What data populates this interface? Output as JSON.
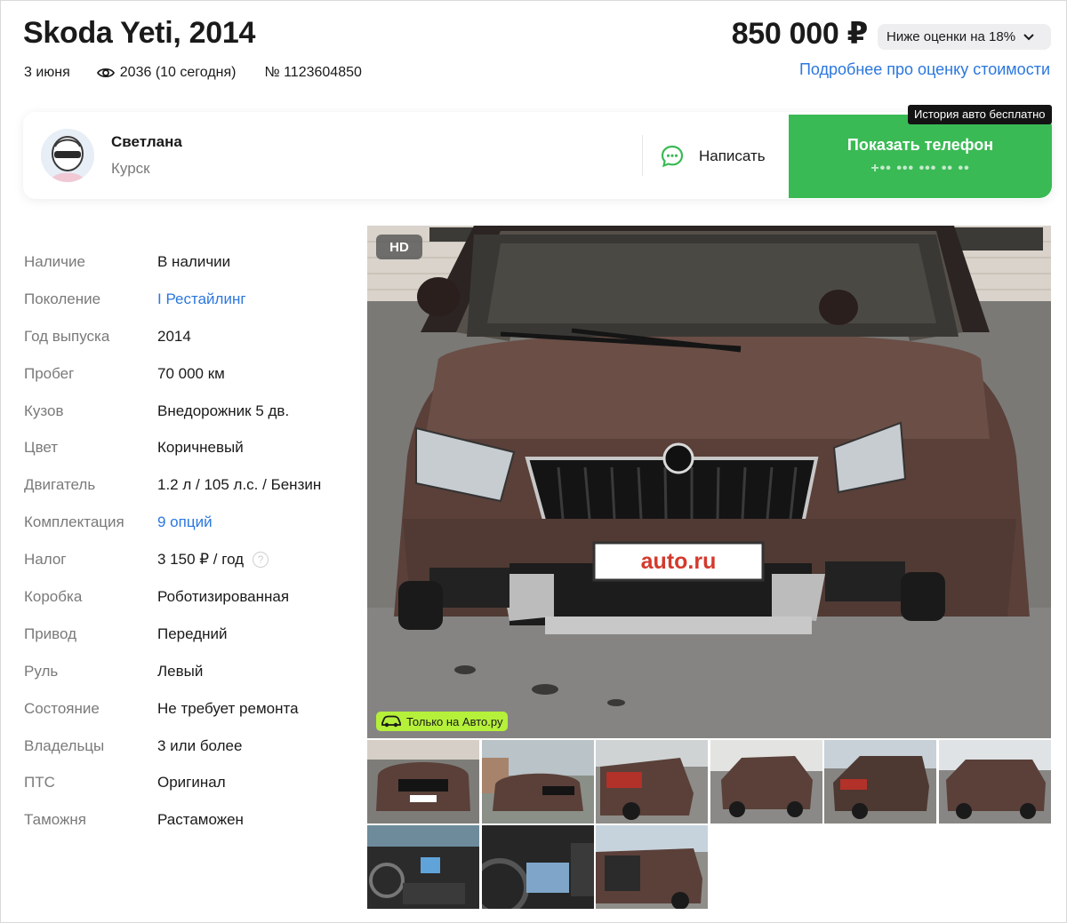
{
  "header": {
    "title": "Skoda Yeti, 2014",
    "date": "3 июня",
    "views": "2036 (10 сегодня)",
    "listing_number": "№ 1123604850",
    "price": "850 000 ₽",
    "rating_badge": "Ниже оценки на 18%",
    "rating_link": "Подробнее про оценку стоимости"
  },
  "seller": {
    "name": "Светлана",
    "city": "Курск",
    "write_label": "Написать",
    "phone_label": "Показать телефон",
    "phone_mask": "+•• ••• ••• •• ••",
    "history_tooltip": "История авто бесплатно"
  },
  "specs": [
    {
      "key": "Наличие",
      "value": "В наличии"
    },
    {
      "key": "Поколение",
      "value": "I Рестайлинг"
    },
    {
      "key": "Год выпуска",
      "value": "2014"
    },
    {
      "key": "Пробег",
      "value": "70 000 км"
    },
    {
      "key": "Кузов",
      "value": "Внедорожник 5 дв."
    },
    {
      "key": "Цвет",
      "value": "Коричневый"
    },
    {
      "key": "Двигатель",
      "value": "1.2 л / 105 л.с. / Бензин"
    },
    {
      "key": "Комплектация",
      "value": "9 опций"
    },
    {
      "key": "Налог",
      "value": "3 150 ₽ / год"
    },
    {
      "key": "Коробка",
      "value": "Роботизированная"
    },
    {
      "key": "Привод",
      "value": "Передний"
    },
    {
      "key": "Руль",
      "value": "Левый"
    },
    {
      "key": "Состояние",
      "value": "Не требует ремонта"
    },
    {
      "key": "Владельцы",
      "value": "3 или более"
    },
    {
      "key": "ПТС",
      "value": "Оригинал"
    },
    {
      "key": "Таможня",
      "value": "Растаможен"
    }
  ],
  "gallery": {
    "hd_badge": "HD",
    "only_badge": "Только на Авто.ру",
    "plate_text": "auto.ru",
    "thumbnail_count": 9
  },
  "colors": {
    "accent_green": "#3aba55",
    "link_blue": "#2b77de",
    "badge_lime": "#b5f03a",
    "car_brown": "#5a4039"
  },
  "icons": {
    "views": "eye-icon",
    "rating_chevron": "chevron-down-icon",
    "write": "chat-bubble-icon",
    "tax_help": "question-icon",
    "only_badge": "car-icon"
  }
}
